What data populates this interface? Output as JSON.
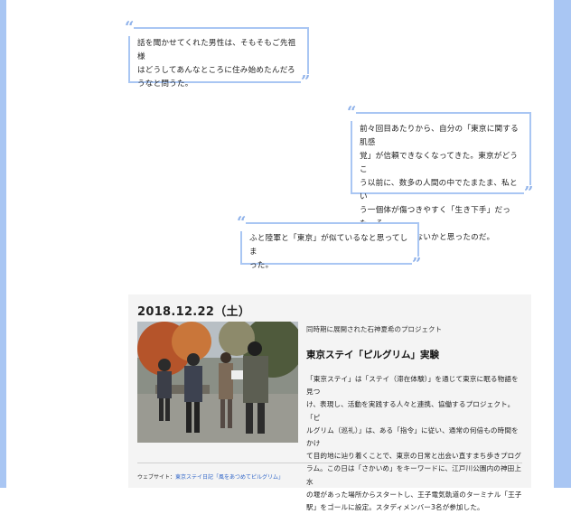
{
  "quotes": [
    {
      "open_mark": "“",
      "close_mark": "”",
      "lines": [
        "話を聞かせてくれた男性は、そもそもご先祖様",
        "はどうしてあんなところに住み始めたんだろ",
        "うなと問うた。"
      ]
    },
    {
      "open_mark": "“",
      "close_mark": "”",
      "lines": [
        "前々回目あたりから、自分の「東京に関する肌感",
        "覚」が信頼できなくなってきた。東京がどうこ",
        "う以前に、数多の人間の中でたまたま、私とい",
        "う一個体が傷つきやすく「生き下手」だった、そ",
        "れだけなのではないかと思ったのだ。"
      ]
    },
    {
      "open_mark": "“",
      "close_mark": "”",
      "lines": [
        "ふと陸軍と「東京」が似ているなと思ってしま",
        "った。"
      ]
    }
  ],
  "event": {
    "date": "2018.12.22（土）",
    "subtitle": "同時期に展開された石神夏希のプロジェクト",
    "title": "東京ステイ「ピルグリム」実験",
    "body_lines": [
      "「東京ステイ」は「ステイ（滞在体験）」を通じて東京に眠る物語を見つ",
      "け、表現し、活動を実践する人々と連携、協働するプロジェクト。「ピ",
      "ルグリム（巡礼）」は、ある「指令」に従い、通常の何倍もの時間をかけ",
      "て目的地に辿り着くことで、東京の日常と出会い直すまち歩きプログ",
      "ラム。この日は「さかいめ」をキーワードに、江戸川公園内の神田上水",
      "の堰があった場所からスタートし、王子電気軌道のターミナル「王子",
      "駅」をゴールに設定。スタディメンバー3名が参加した。"
    ],
    "footer_label": "ウェブサイト：",
    "footer_link": "東京ステイ日記「風をあつめてピルグリム」",
    "photo_alt": "group-walking-photo"
  },
  "colors": {
    "accent": "#a9c6f3",
    "quote_mark": "#8fb2ea",
    "card_bg": "#f4f4f4",
    "link": "#3569c9"
  }
}
